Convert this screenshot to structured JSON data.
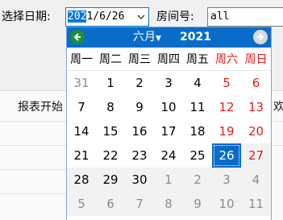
{
  "form": {
    "date_label": "选择日期:",
    "date_value_selected": "202",
    "date_value_rest": "1/6/26",
    "room_label": "房间号:",
    "room_value": "all"
  },
  "background": {
    "column_header": "报表开始",
    "column_header_right": "欢"
  },
  "calendar": {
    "month": "六月",
    "year": "2021",
    "header_color": "#0a6cc9",
    "weekend_color": "#e31b1b",
    "weekdays": [
      "周一",
      "周二",
      "周三",
      "周四",
      "周五",
      "周六",
      "周日"
    ],
    "selected_day": "26",
    "weeks": [
      [
        "31",
        "1",
        "2",
        "3",
        "4",
        "5",
        "6"
      ],
      [
        "7",
        "8",
        "9",
        "10",
        "11",
        "12",
        "13"
      ],
      [
        "14",
        "15",
        "16",
        "17",
        "18",
        "19",
        "20"
      ],
      [
        "21",
        "22",
        "23",
        "24",
        "25",
        "26",
        "27"
      ],
      [
        "28",
        "29",
        "30",
        "1",
        "2",
        "3",
        "4"
      ],
      [
        "5",
        "6",
        "7",
        "8",
        "9",
        "10",
        "11"
      ]
    ]
  }
}
